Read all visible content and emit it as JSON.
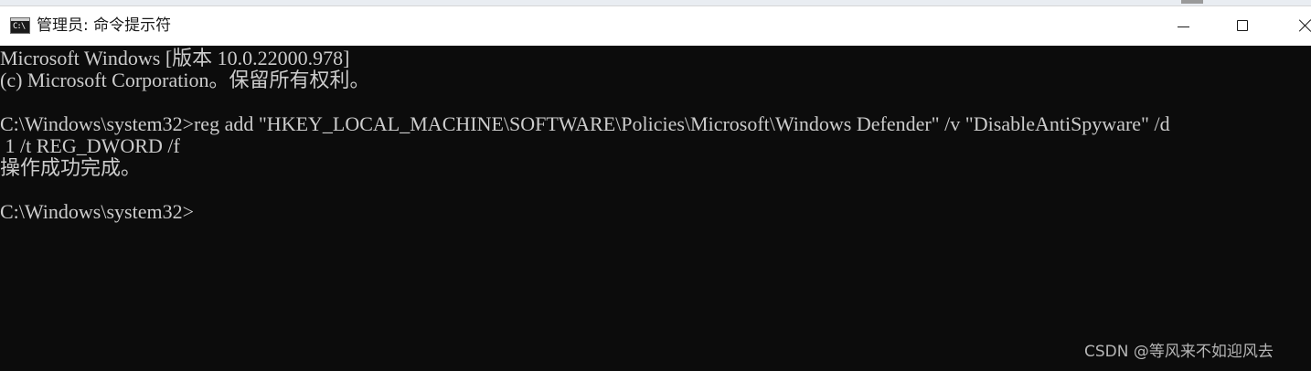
{
  "window": {
    "title": "管理员: 命令提示符",
    "icon": "cmd-icon",
    "icon_glyph": "C:\\",
    "controls": [
      "minimize-icon",
      "maximize-icon",
      "close-icon"
    ]
  },
  "console": {
    "lines": [
      "Microsoft Windows [版本 10.0.22000.978]",
      "(c) Microsoft Corporation。保留所有权利。",
      "",
      "C:\\Windows\\system32>reg add \"HKEY_LOCAL_MACHINE\\SOFTWARE\\Policies\\Microsoft\\Windows Defender\" /v \"DisableAntiSpyware\" /d",
      " 1 /t REG_DWORD /f",
      "操作成功完成。",
      "",
      "C:\\Windows\\system32>"
    ]
  },
  "watermark": "CSDN @等风来不如迎风去",
  "colors": {
    "console_bg": "#0c0c0c",
    "console_text": "#cccccc",
    "titlebar_bg": "#ffffff"
  }
}
